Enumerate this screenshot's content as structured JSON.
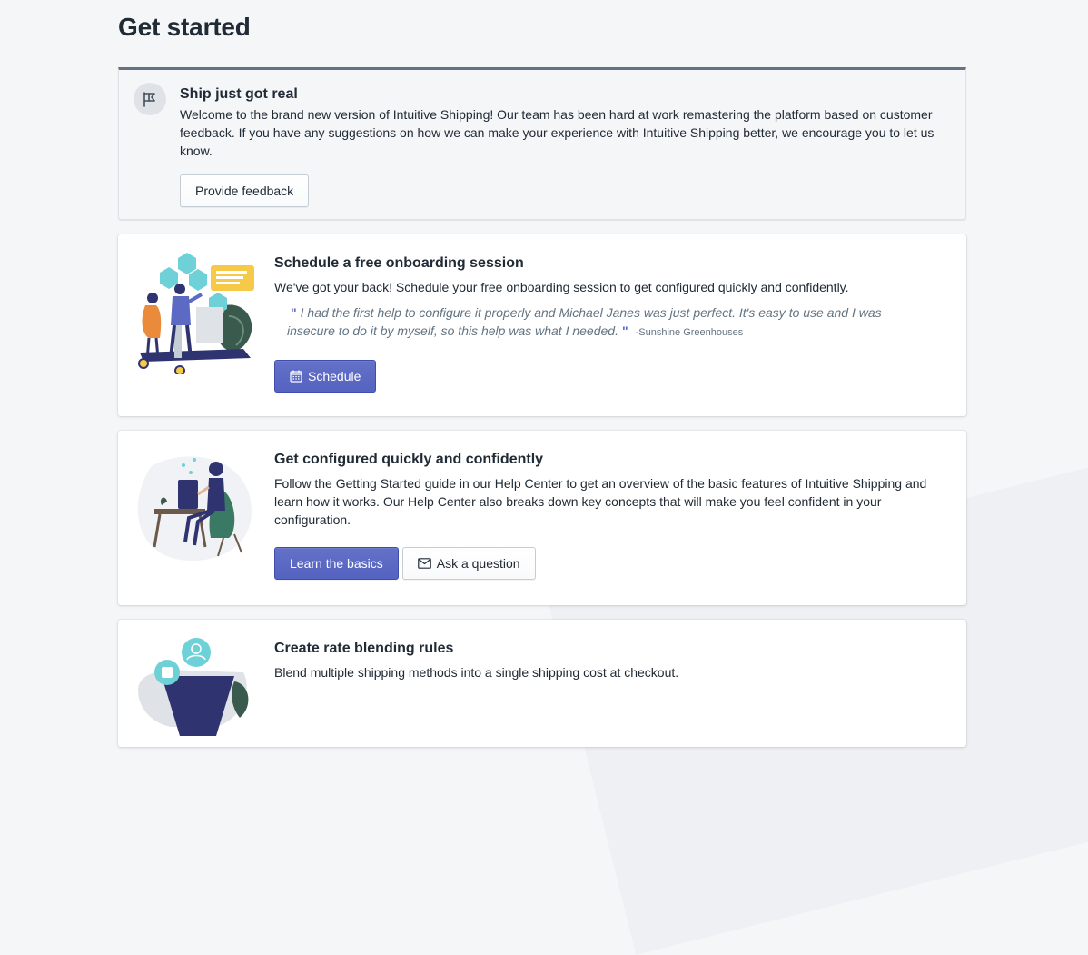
{
  "page": {
    "title": "Get started"
  },
  "banner": {
    "icon": "flag-icon",
    "title": "Ship just got real",
    "text": "Welcome to the brand new version of Intuitive Shipping! Our team has been hard at work remastering the platform based on customer feedback. If you have any suggestions on how we can make your experience with Intuitive Shipping better, we encourage you to let us know.",
    "button_label": "Provide feedback"
  },
  "cards": [
    {
      "title": "Schedule a free onboarding session",
      "text": "We've got your back! Schedule your free onboarding session to get configured quickly and confidently.",
      "quote": {
        "text": "I had the first help to configure it properly and Michael Janes was just perfect. It's easy to use and I was insecure to do it by myself, so this help was what I needed.",
        "author": "-Sunshine Greenhouses"
      },
      "primary_button": {
        "label": "Schedule",
        "icon": "calendar-icon"
      }
    },
    {
      "title": "Get configured quickly and confidently",
      "text": "Follow the Getting Started guide in our Help Center to get an overview of the basic features of Intuitive Shipping and learn how it works. Our Help Center also breaks down key concepts that will make you feel confident in your configuration.",
      "primary_button": {
        "label": "Learn the basics"
      },
      "secondary_button": {
        "label": "Ask a question",
        "icon": "envelope-icon"
      }
    },
    {
      "title": "Create rate blending rules",
      "text": "Blend multiple shipping methods into a single shipping cost at checkout."
    }
  ],
  "colors": {
    "primary": "#5c6ac4",
    "teal": "#6fd1d8",
    "navy": "#2f3470",
    "yellow": "#f7c948"
  }
}
